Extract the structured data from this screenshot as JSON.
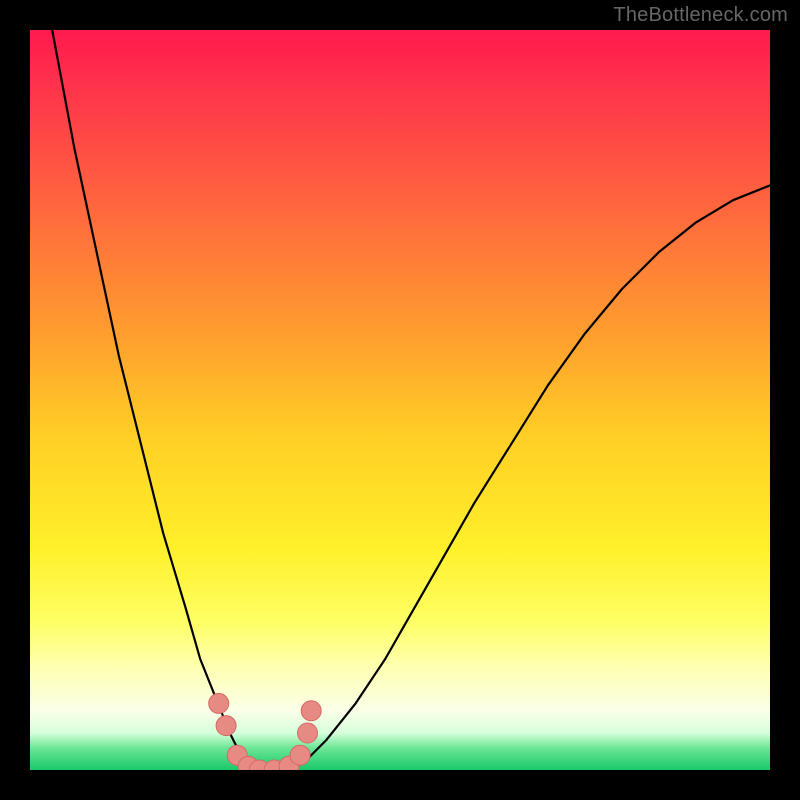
{
  "watermark": "TheBottleneck.com",
  "colors": {
    "curve": "#000000",
    "marker_fill": "#e88a84",
    "marker_stroke": "#d46a64"
  },
  "chart_data": {
    "type": "line",
    "title": "",
    "xlabel": "",
    "ylabel": "",
    "xlim": [
      0,
      100
    ],
    "ylim": [
      0,
      100
    ],
    "note": "y is bottleneck % (0 = green/optimal, 100 = red/severe). Curve was read off the vertical gradient; the optimal flat valley sits near x≈29–36.",
    "x": [
      0,
      3,
      6,
      9,
      12,
      15,
      18,
      21,
      23,
      25,
      27,
      29,
      31,
      33,
      35,
      37,
      40,
      44,
      48,
      52,
      56,
      60,
      65,
      70,
      75,
      80,
      85,
      90,
      95,
      100
    ],
    "y": [
      120,
      100,
      84,
      70,
      56,
      44,
      32,
      22,
      15,
      10,
      5,
      1,
      0,
      0,
      0,
      1,
      4,
      9,
      15,
      22,
      29,
      36,
      44,
      52,
      59,
      65,
      70,
      74,
      77,
      79
    ],
    "markers": {
      "note": "salmon dots near the valley indicating good-fit hardware",
      "points": [
        {
          "x": 25.5,
          "y": 9
        },
        {
          "x": 26.5,
          "y": 6
        },
        {
          "x": 28.0,
          "y": 2
        },
        {
          "x": 29.5,
          "y": 0.5
        },
        {
          "x": 31.0,
          "y": 0
        },
        {
          "x": 33.0,
          "y": 0
        },
        {
          "x": 35.0,
          "y": 0.5
        },
        {
          "x": 36.5,
          "y": 2
        },
        {
          "x": 37.5,
          "y": 5
        },
        {
          "x": 38.0,
          "y": 8
        }
      ],
      "radius": 10
    }
  }
}
